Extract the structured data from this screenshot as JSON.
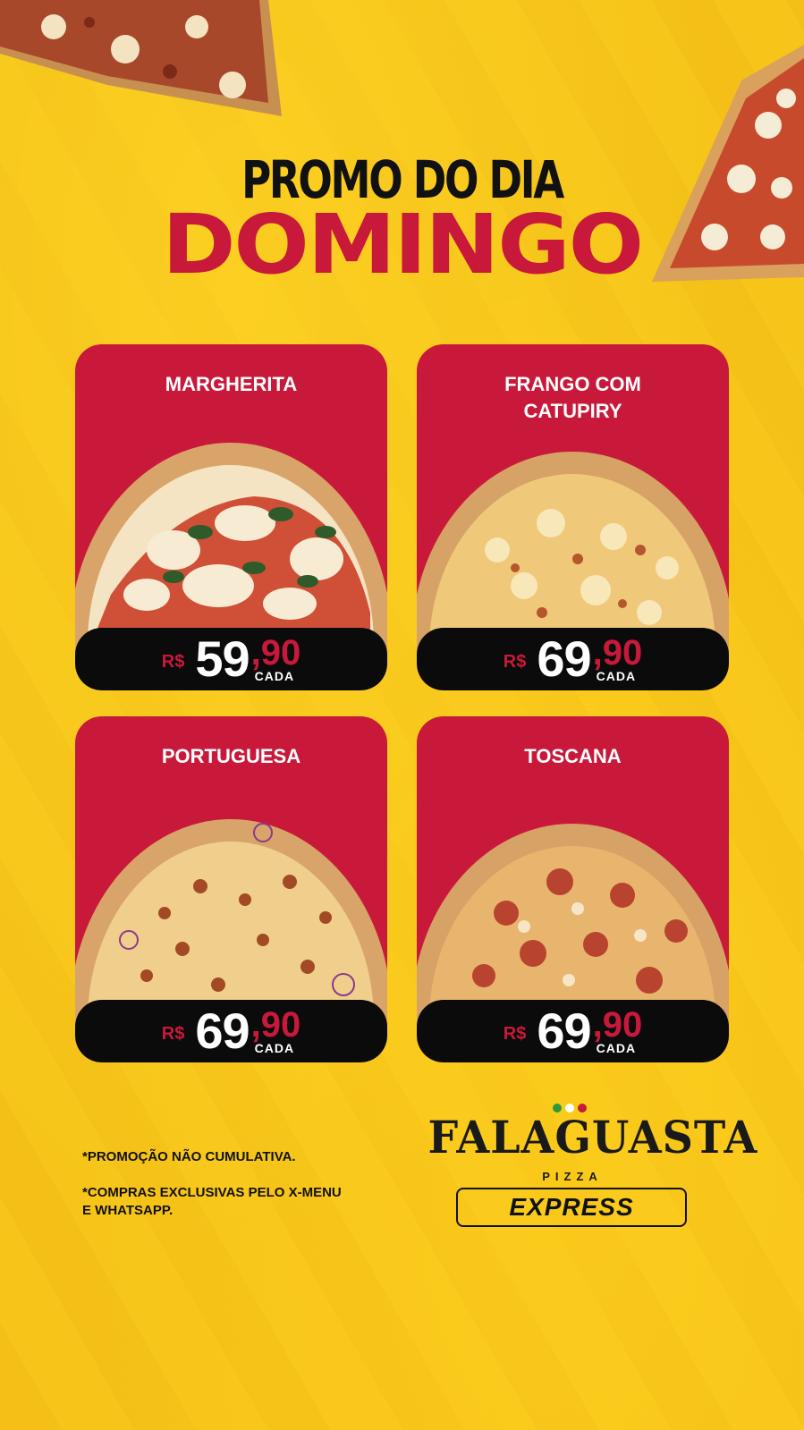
{
  "headline": {
    "line1_a": "PROMO",
    "line1_b": "DO DIA",
    "line2": "DOMINGO"
  },
  "cards": [
    {
      "title": "MARGHERITA",
      "currency": "R$",
      "price_int": "59",
      "price_dec": ",90",
      "unit": "CADA",
      "pizza_icon": "margherita-pizza-icon"
    },
    {
      "title": "FRANGO COM CATUPIRY",
      "currency": "R$",
      "price_int": "69",
      "price_dec": ",90",
      "unit": "CADA",
      "pizza_icon": "frango-catupiry-pizza-icon"
    },
    {
      "title": "PORTUGUESA",
      "currency": "R$",
      "price_int": "69",
      "price_dec": ",90",
      "unit": "CADA",
      "pizza_icon": "portuguesa-pizza-icon"
    },
    {
      "title": "TOSCANA",
      "currency": "R$",
      "price_int": "69",
      "price_dec": ",90",
      "unit": "CADA",
      "pizza_icon": "toscana-pizza-icon"
    }
  ],
  "notes": {
    "note1": "*PROMOÇÃO NÃO CUMULATIVA.",
    "note2": "*COMPRAS EXCLUSIVAS PELO X-MENU E WHATSAPP."
  },
  "logo": {
    "brand": "FALAGUASTA",
    "sub": "PIZZA",
    "tag": "EXPRESS"
  },
  "colors": {
    "background": "#f7c51a",
    "card": "#c8193a",
    "price_bar": "#0b0b0b",
    "accent_red": "#c8193a"
  }
}
